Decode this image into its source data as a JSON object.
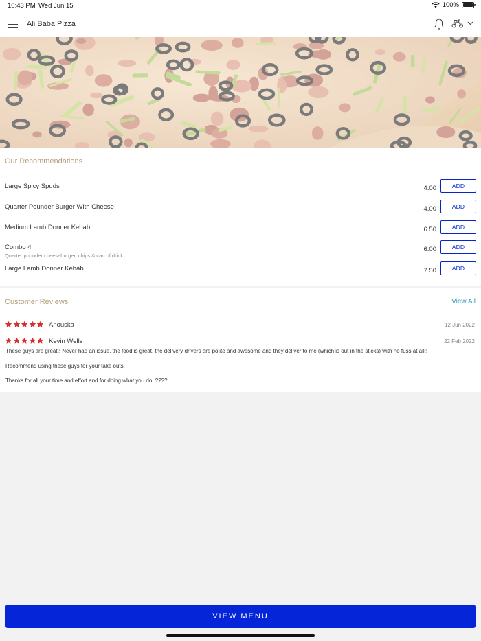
{
  "status_bar": {
    "time": "10:43 PM",
    "date": "Wed Jun 15",
    "battery": "100%",
    "battery_level": 1.0
  },
  "header": {
    "title": "Ali Baba Pizza",
    "icons": [
      "menu-icon",
      "bell-icon",
      "delivery-scooter-icon",
      "chevron-down-icon"
    ]
  },
  "recommendations": {
    "title": "Our Recommendations",
    "items": [
      {
        "name": "Large Spicy Spuds",
        "description": "",
        "price": "4.00",
        "button": "ADD"
      },
      {
        "name": "Quarter Pounder Burger With Cheese",
        "description": "",
        "price": "4.00",
        "button": "ADD"
      },
      {
        "name": "Medium Lamb Donner Kebab",
        "description": "",
        "price": "6.50",
        "button": "ADD"
      },
      {
        "name": "Combo 4",
        "description": "Quarter pounder cheeseburger, chips & can of drink",
        "price": "6.00",
        "button": "ADD"
      },
      {
        "name": "Large Lamb Donner Kebab",
        "description": "",
        "price": "7.50",
        "button": "ADD"
      }
    ]
  },
  "reviews": {
    "title": "Customer Reviews",
    "view_all": "View All",
    "items": [
      {
        "name": "Anouska",
        "date": "12 Jun 2022",
        "rating": 5,
        "paragraphs": []
      },
      {
        "name": "Kevin Wells",
        "date": "22 Feb 2022",
        "rating": 5,
        "paragraphs": [
          "These guys are great!! Never had an issue, the food is great, the delivery drivers are polite and awesome and they deliver to me (which is out in the sticks) with no fuss at all!!",
          "Recommend using these guys for your take outs.",
          "Thanks for all your time and effort and for doing what you do. ????"
        ]
      }
    ]
  },
  "footer": {
    "view_menu": "VIEW MENU"
  },
  "colors": {
    "accent_blue": "#0525d8",
    "section_title": "#b59f78",
    "view_all": "#2b9fb4",
    "star": "#d8302e"
  }
}
